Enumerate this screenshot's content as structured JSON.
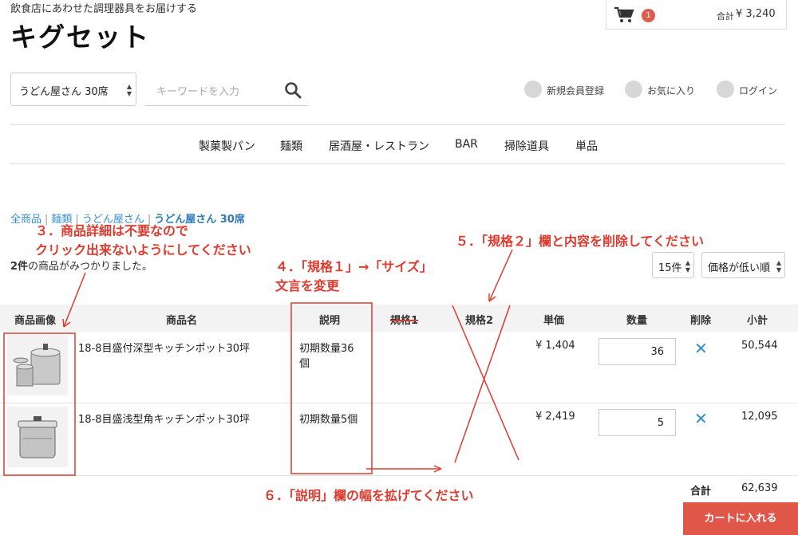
{
  "header": {
    "tagline": "飲食店にあわせた調理器具をお届けする",
    "logo": "キグセット",
    "cart_count": "1",
    "cart_total_label": "合計",
    "cart_total": "¥ 3,240"
  },
  "search": {
    "category": "うどん屋さん 30席",
    "placeholder": "キーワードを入力"
  },
  "member_links": [
    "新規会員登録",
    "お気に入り",
    "ログイン"
  ],
  "nav": [
    "製菓製パン",
    "麺類",
    "居酒屋・レストラン",
    "BAR",
    "掃除道具",
    "単品"
  ],
  "breadcrumb": [
    "全商品",
    "麺類",
    "うどん屋さん",
    "うどん屋さん 30席"
  ],
  "result": {
    "count": "2件",
    "suffix": "の商品がみつかりました。"
  },
  "list_controls": {
    "per_page": "15件",
    "sort": "価格が低い順"
  },
  "table": {
    "headers": {
      "image": "商品画像",
      "name": "商品名",
      "desc": "説明",
      "spec1": "規格1",
      "spec2": "規格2",
      "price": "単価",
      "qty": "数量",
      "delete": "削除",
      "subtotal": "小計"
    },
    "rows": [
      {
        "name": "18-8目盛付深型キッチンポット30坪",
        "desc1": "初期数量36",
        "desc2": "個",
        "price": "¥ 1,404",
        "qty": "36",
        "subtotal": "50,544"
      },
      {
        "name": "18-8目盛浅型角キッチンポット30坪",
        "desc1": "初期数量5個",
        "desc2": "",
        "price": "¥ 2,419",
        "qty": "5",
        "subtotal": "12,095"
      }
    ],
    "total_label": "合計",
    "total": "62,639"
  },
  "cta": "カートに入れる",
  "annotations": {
    "note3_line1": "３．商品詳細は不要なので",
    "note3_line2": "クリック出来ないようにしてください",
    "note4_line1": "４．「規格１」→「サイズ」",
    "note4_line2": "文言を変更",
    "note5": "５．「規格２」欄と内容を削除してください",
    "note6": "６．「説明」欄の幅を拡げてください"
  },
  "colors": {
    "accent": "#e0574a",
    "link": "#3a8fd0",
    "annotation": "#e03a2e"
  }
}
